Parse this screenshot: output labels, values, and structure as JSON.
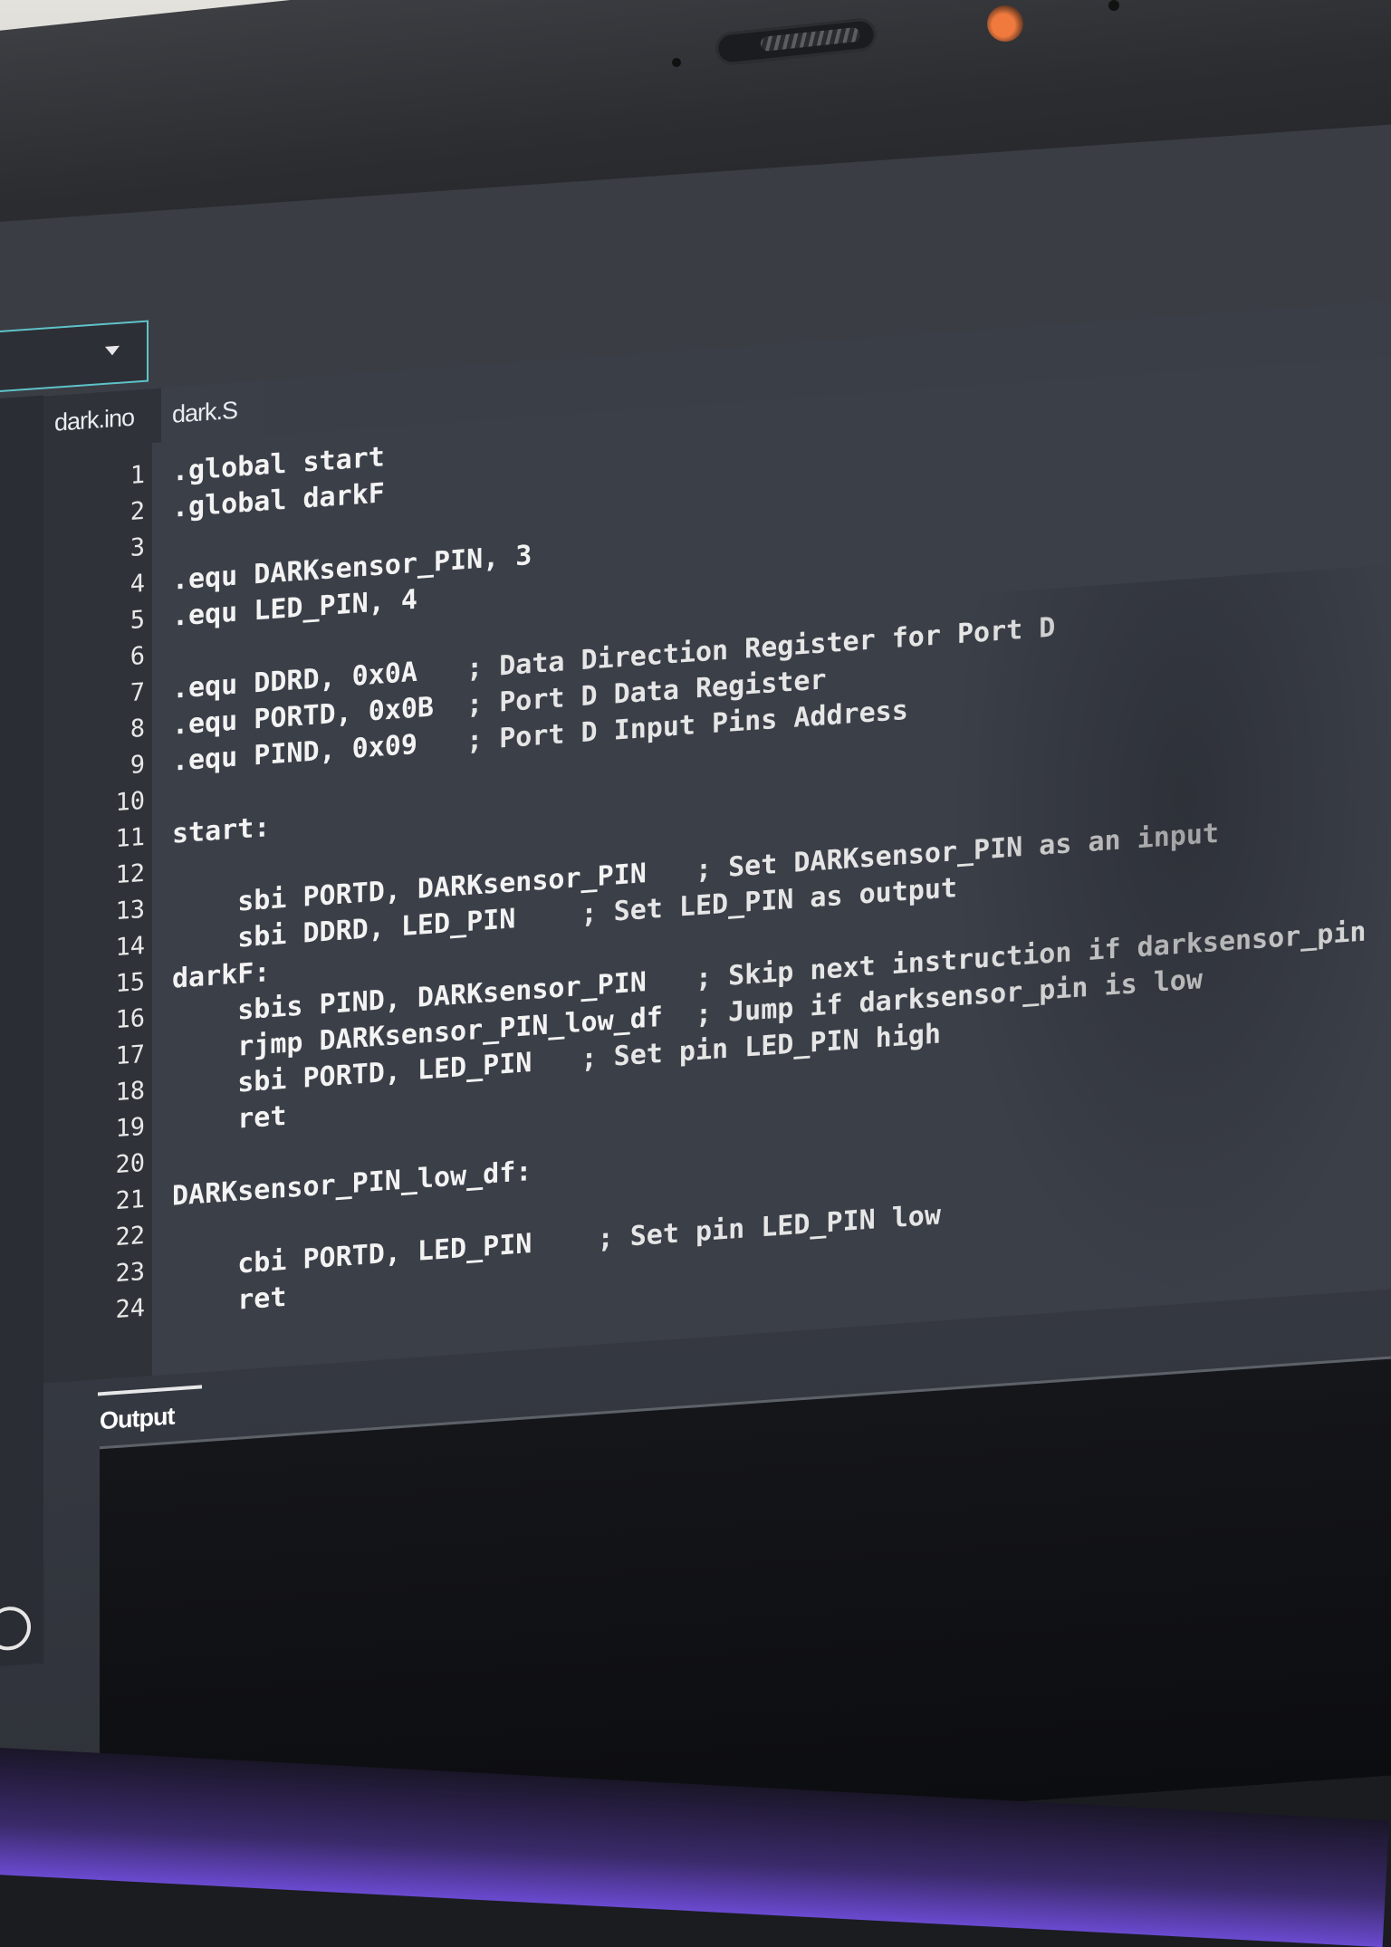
{
  "tabs": [
    {
      "label": "dark.ino"
    },
    {
      "label": "dark.S"
    }
  ],
  "code_lines": [
    {
      "num": "1",
      "code": ".global start",
      "comment": ""
    },
    {
      "num": "2",
      "code": ".global darkF",
      "comment": ""
    },
    {
      "num": "3",
      "code": "",
      "comment": ""
    },
    {
      "num": "4",
      "code": ".equ DARKsensor_PIN, 3",
      "comment": ""
    },
    {
      "num": "5",
      "code": ".equ LED_PIN, 4",
      "comment": ""
    },
    {
      "num": "6",
      "code": "",
      "comment": ""
    },
    {
      "num": "7",
      "code": ".equ DDRD, 0x0A   ",
      "comment": "; Data Direction Register for Port D"
    },
    {
      "num": "8",
      "code": ".equ PORTD, 0x0B  ",
      "comment": "; Port D Data Register"
    },
    {
      "num": "9",
      "code": ".equ PIND, 0x09   ",
      "comment": "; Port D Input Pins Address"
    },
    {
      "num": "10",
      "code": "",
      "comment": ""
    },
    {
      "num": "11",
      "code": "start:",
      "comment": ""
    },
    {
      "num": "12",
      "code": "",
      "comment": ""
    },
    {
      "num": "13",
      "code": "    sbi PORTD, DARKsensor_PIN   ",
      "comment": "; Set DARKsensor_PIN as an input"
    },
    {
      "num": "14",
      "code": "    sbi DDRD, LED_PIN    ",
      "comment": "; Set LED_PIN as output"
    },
    {
      "num": "15",
      "code": "darkF:",
      "comment": ""
    },
    {
      "num": "16",
      "code": "    sbis PIND, DARKsensor_PIN   ",
      "comment": "; Skip next instruction if darksensor_pin"
    },
    {
      "num": "17",
      "code": "    rjmp DARKsensor_PIN_low_df  ",
      "comment": "; Jump if darksensor_pin is low"
    },
    {
      "num": "18",
      "code": "    sbi PORTD, LED_PIN   ",
      "comment": "; Set pin LED_PIN high"
    },
    {
      "num": "19",
      "code": "    ret",
      "comment": ""
    },
    {
      "num": "20",
      "code": "",
      "comment": ""
    },
    {
      "num": "21",
      "code": "DARKsensor_PIN_low_df:",
      "comment": ""
    },
    {
      "num": "22",
      "code": "",
      "comment": ""
    },
    {
      "num": "23",
      "code": "    cbi PORTD, LED_PIN    ",
      "comment": "; Set pin LED_PIN low"
    },
    {
      "num": "24",
      "code": "    ret",
      "comment": ""
    }
  ],
  "output": {
    "label": "Output"
  },
  "colors": {
    "editor_bg": "#3b3f48",
    "gutter_bg": "#2f3238",
    "accent": "#5fc3c9"
  }
}
